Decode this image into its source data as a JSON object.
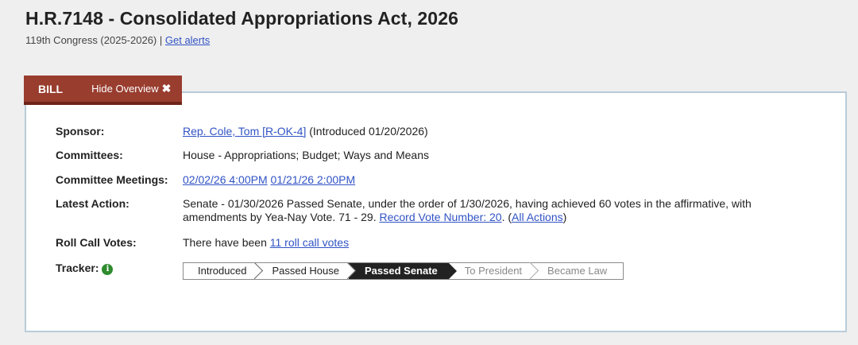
{
  "header": {
    "title": "H.R.7148 - Consolidated Appropriations Act, 2026",
    "congress": "119th Congress (2025-2026)",
    "separator": " | ",
    "alerts_link": "Get alerts"
  },
  "tabs": {
    "bill": "BILL",
    "hide_overview": "Hide Overview"
  },
  "overview": {
    "sponsor_label": "Sponsor:",
    "sponsor_link": "Rep. Cole, Tom [R-OK-4]",
    "sponsor_intro": " (Introduced 01/20/2026)",
    "committees_label": "Committees:",
    "committees_value": "House - Appropriations; Budget; Ways and Means",
    "meetings_label": "Committee Meetings:",
    "meetings": [
      "02/02/26 4:00PM",
      "01/21/26 2:00PM"
    ],
    "latest_label": "Latest Action:",
    "latest_text": "Senate - 01/30/2026 Passed Senate, under the order of 1/30/2026, having achieved 60 votes in the affirmative, with amendments by Yea-Nay Vote. 71 - 29. ",
    "record_vote_link": "Record Vote Number: 20",
    "latest_tail": ".  (",
    "all_actions_link": "All Actions",
    "latest_close": ")",
    "roll_label": "Roll Call Votes:",
    "roll_prefix": "There have been ",
    "roll_link": "11 roll call votes",
    "tracker_label": "Tracker:"
  },
  "tracker": {
    "steps": [
      "Introduced",
      "Passed House",
      "Passed Senate",
      "To President",
      "Became Law"
    ],
    "current_index": 2
  },
  "icons": {
    "close": "x-icon",
    "info": "info-icon"
  },
  "colors": {
    "tab_bg": "#993d2f",
    "link": "#3153c4",
    "panel_border": "#b8ccd8",
    "info_green": "#2e8b2e"
  }
}
